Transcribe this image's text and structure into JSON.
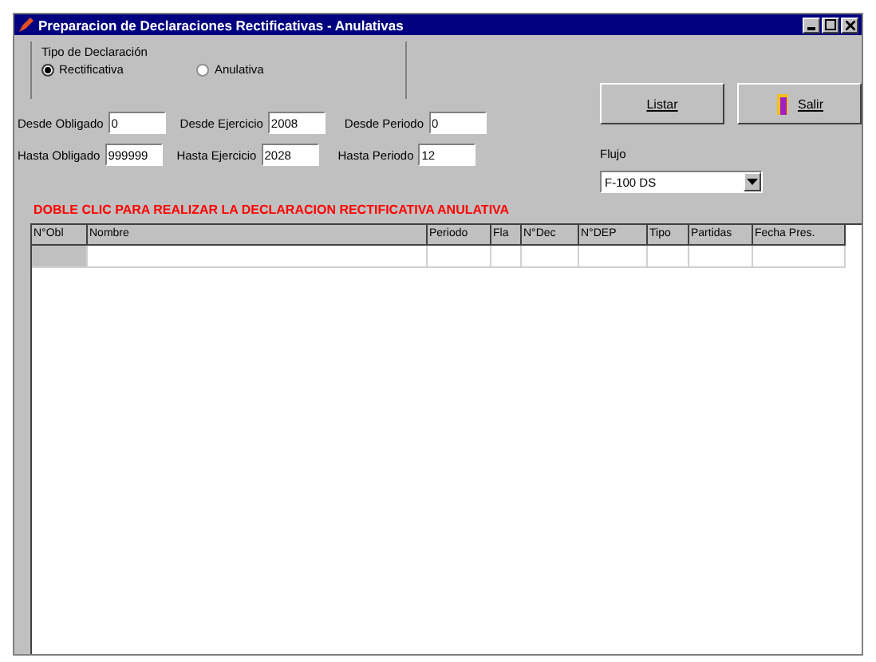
{
  "window": {
    "title": "Preparacion de Declaraciones Rectificativas - Anulativas"
  },
  "tipo_declaracion": {
    "label": "Tipo de Declaración",
    "options": [
      {
        "label": "Rectificativa",
        "selected": true
      },
      {
        "label": "Anulativa",
        "selected": false
      }
    ]
  },
  "buttons": [
    {
      "label": "Listar",
      "kind": "text"
    },
    {
      "label": "Salir",
      "kind": "exit"
    }
  ],
  "fields_row_1": [
    {
      "label": "Desde Obligado",
      "value": "0"
    },
    {
      "label": "Desde Ejercicio",
      "value": "2008"
    },
    {
      "label": "Desde Periodo",
      "value": "0"
    }
  ],
  "fields_row_2": [
    {
      "label": "Hasta Obligado",
      "value": "999999"
    },
    {
      "label": "Hasta Ejercicio",
      "value": "2028"
    },
    {
      "label": "Hasta Periodo",
      "value": "12"
    }
  ],
  "flujo": {
    "label": "Flujo",
    "value": "F-100 DS"
  },
  "instruction": "DOBLE CLIC PARA REALIZAR LA DECLARACION RECTIFICATIVA ANULATIVA",
  "table": {
    "columns": [
      "N°Obl",
      "Nombre",
      "Periodo",
      "Fla",
      "N°Dec",
      "N°DEP",
      "Tipo",
      "Partidas",
      "Fecha Pres."
    ]
  }
}
